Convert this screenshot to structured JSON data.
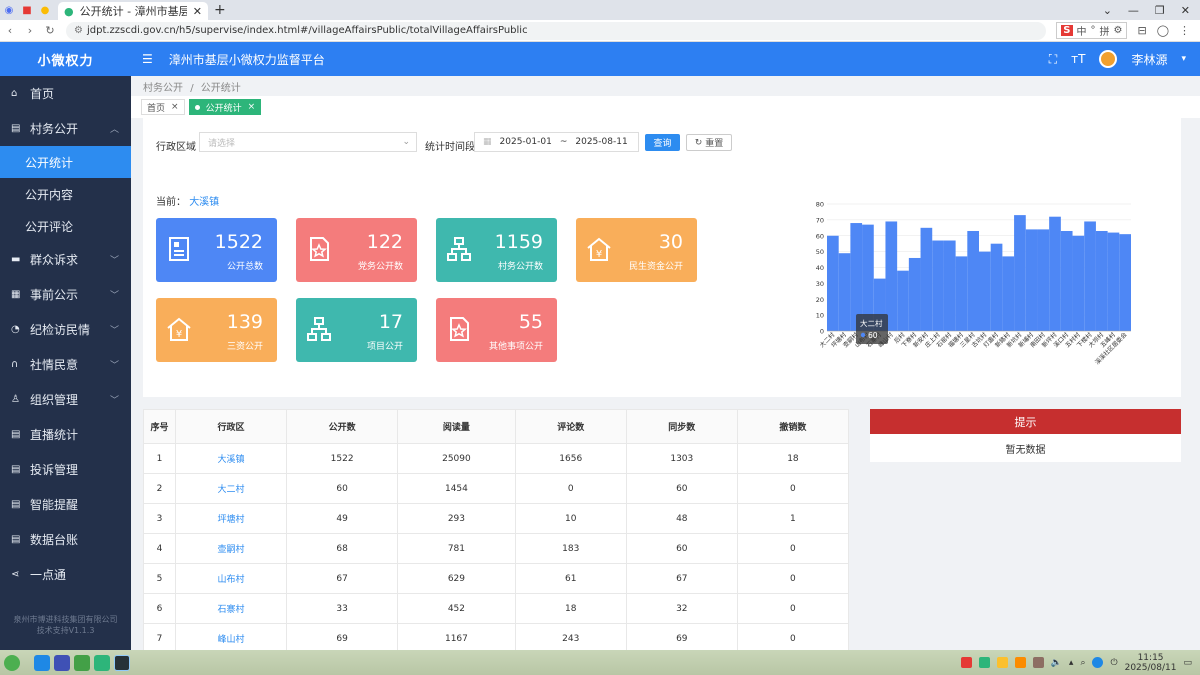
{
  "browser": {
    "tab_title": "公开统计 - 漳州市基层小微权力监督平台",
    "url": "jdpt.zzscdi.gov.cn/h5/supervise/index.html#/villageAffairsPublic/totalVillageAffairsPublic",
    "ime": {
      "cn": "中",
      "sym": "°",
      "pin": "拼"
    }
  },
  "app": {
    "logo": "小微权力",
    "platform_title": "漳州市基层小微权力监督平台",
    "user_name": "李林源"
  },
  "sidebar": {
    "home": "首页",
    "village_public": "村务公开",
    "sub": {
      "stats": "公开统计",
      "content": "公开内容",
      "comment": "公开评论"
    },
    "items": [
      "群众诉求",
      "事前公示",
      "纪检访民情",
      "社情民意",
      "组织管理",
      "直播统计",
      "投诉管理",
      "智能提醒",
      "数据台账",
      "一点通"
    ],
    "copyright_line1": "泉州市博进科技集团有限公司",
    "copyright_line2": "技术支持V1.1.3"
  },
  "breadcrumb": {
    "parent": "村务公开",
    "sep": "/",
    "current": "公开统计"
  },
  "tags": {
    "home": "首页",
    "stats": "公开统计"
  },
  "filter": {
    "region_label": "行政区域",
    "region_placeholder": "请选择",
    "time_label": "统计时间段",
    "date_start": "2025-01-01",
    "date_sep": "~",
    "date_end": "2025-08-11",
    "query": "查询",
    "reset": "重置"
  },
  "current": {
    "label": "当前：",
    "value": "大溪镇"
  },
  "cards": [
    {
      "num": "1522",
      "label": "公开总数",
      "color": "#4e87f5",
      "icon": "document-icon"
    },
    {
      "num": "122",
      "label": "党务公开数",
      "color": "#f47c7c",
      "icon": "star-doc-icon"
    },
    {
      "num": "1159",
      "label": "村务公开数",
      "color": "#3fb8ae",
      "icon": "org-chart-icon"
    },
    {
      "num": "30",
      "label": "民生资金公开",
      "color": "#f9ae5a",
      "icon": "yuan-house-icon"
    },
    {
      "num": "139",
      "label": "三资公开",
      "color": "#f9ae5a",
      "icon": "yuan-house-icon"
    },
    {
      "num": "17",
      "label": "项目公开",
      "color": "#3fb8ae",
      "icon": "org-chart-icon"
    },
    {
      "num": "55",
      "label": "其他事项公开",
      "color": "#f47c7c",
      "icon": "star-doc-icon"
    }
  ],
  "chart_data": {
    "type": "bar",
    "categories": [
      "大二村",
      "坪塘村",
      "壶嗣村",
      "山布村",
      "石寨村",
      "峰山村",
      "后村",
      "下寮村",
      "新安村",
      "庄上村",
      "石窑村",
      "福塘村",
      "三星村",
      "古坑村",
      "灯盏村",
      "新路村",
      "新坑村",
      "新埔村",
      "南田村",
      "新坪村",
      "溪口村",
      "五村村",
      "下楼村",
      "大坝村",
      "五峰村",
      "溪溪社区居委会"
    ],
    "values": [
      60,
      49,
      68,
      67,
      33,
      69,
      38,
      46,
      65,
      57,
      57,
      47,
      63,
      50,
      55,
      47,
      73,
      64,
      64,
      72,
      63,
      60,
      69,
      63,
      62,
      61
    ],
    "ylim": [
      0,
      80
    ],
    "yticks": [
      "0",
      "10",
      "20",
      "30",
      "40",
      "50",
      "60",
      "70",
      "80"
    ],
    "bar_color": "#4e87f5",
    "tooltip": {
      "title": "大二村",
      "value": "60"
    }
  },
  "table": {
    "headers": [
      "序号",
      "行政区",
      "公开数",
      "阅读量",
      "评论数",
      "同步数",
      "撤销数"
    ],
    "rows": [
      [
        "1",
        "大溪镇",
        "1522",
        "25090",
        "1656",
        "1303",
        "18"
      ],
      [
        "2",
        "大二村",
        "60",
        "1454",
        "0",
        "60",
        "0"
      ],
      [
        "3",
        "坪塘村",
        "49",
        "293",
        "10",
        "48",
        "1"
      ],
      [
        "4",
        "壶嗣村",
        "68",
        "781",
        "183",
        "60",
        "0"
      ],
      [
        "5",
        "山布村",
        "67",
        "629",
        "61",
        "67",
        "0"
      ],
      [
        "6",
        "石寨村",
        "33",
        "452",
        "18",
        "32",
        "0"
      ],
      [
        "7",
        "峰山村",
        "69",
        "1167",
        "243",
        "69",
        "0"
      ]
    ]
  },
  "notice": {
    "title": "提示",
    "body": "暂无数据"
  },
  "taskbar": {
    "time": "11:15",
    "date": "2025/08/11"
  }
}
